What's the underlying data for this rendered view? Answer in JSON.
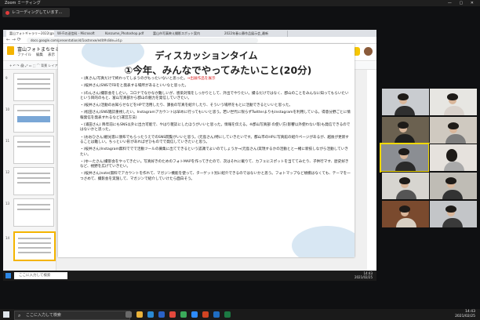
{
  "zoom": {
    "window_title": "Zoom ミーティング",
    "recording_label": "レコーディングしています..."
  },
  "browser": {
    "tabs": [
      "富山フォトギャラリー2022(gallery)",
      "Wi-Fiの送信料 - Microsoft",
      "Konzume_Photoshop.pdf",
      "富山市写真映え撮影スポット案内",
      "2022年春公募作品展示会_最新"
    ],
    "url": "docs.google.com/presentation/d/1ostnnxe/edit#slide=id.p"
  },
  "slides_app": {
    "doc_title": "富山フォトまちセミナー0325upl",
    "menu": [
      "ファイル",
      "編集",
      "表示",
      "挿入",
      "表示形式",
      "スライド",
      "配置",
      "ツール",
      "ヘルプ",
      "最終編集"
    ],
    "present_label": "プレゼンテーションを開始",
    "share_label": "共有",
    "toolbar_text": "+ ↶ ↷ 🖨 ⤢ ▭ ⬚ ⌒ 背景 レイアウト テーマ 切り替え効果"
  },
  "filmstrip": {
    "numbers": [
      "9",
      "10",
      "11",
      "12",
      "13",
      "14"
    ]
  },
  "slide": {
    "title": "ディスカッションタイム",
    "subtitle": "①今年、みんなでやってみたいこと(20分)",
    "notes": [
      {
        "text": "・(真さん)写真だけで終わってしまうのがもったいないと思った。",
        "red": "⇒出展作品を展示"
      },
      {
        "text": "・(桜井さん)SNSでFBをと発表する場所があるといいなと思った。",
        "red": ""
      },
      {
        "text": "・(のんさん)撮影会をしたい。コロナでなかなか難しいが、感染対策をしっかりとして、外出でやりたい。撮るだけではなく、郡山のことをみんなに知ってもらいたいという目的のもと、富山写真部から郡山の魅力を発信していきたい。",
        "red": ""
      },
      {
        "text": "・(桜井さん)活動のお知らせなどをHPで活用したり、課長の写真を紹介したり、そういう場所をもとに活動できるといいと思った。",
        "red": ""
      },
      {
        "text": "・(松田さん)SNS雑誌重視したい。Instagramアカウントは早めに行ってもいいと思う。若い世代に限らずTwitterよりもInstagramを利用している。得意分野ごとに情報発信を発表すれるなど(運営方法)",
        "red": ""
      },
      {
        "text": "・(浦田さん) 降年前にもSNS以外に出力可能で、やはり雑誌にしたほうがいいと思った。情報を伝える。",
        "red": "※郡山写真部 の使い方(影響以外使わない等)も発信できるのではないかと思った。"
      },
      {
        "text": "・(おおひさん)観光客に頒布でもらったうえでのSNS閲覧がいいと思う。(元島さん)特にしていきたいです。都山市のHPに写真館の紹介ページがあるが、越後が更新することは難しい。ちっといい形があればぜひものでで発信していきたいと思う。",
        "red": ""
      },
      {
        "text": "・(桜井さん)Instagram無料ででで活動ツールの募集に出てできるという認識でよいのでしょうか→(元島さん)実現するかの活動とと一緒に新技しながら活動していきたい。",
        "red": ""
      },
      {
        "text": "・(ゆーたさん)撮影会をやってきたい。写真好きのためのフォトMAPを作ってきたので、次はそれに載りて、カフェにスポットを当ててみたり、子供行マす、歴史好きなど、視野を広げていきたい。",
        "red": ""
      },
      {
        "text": "・(桜井さん)note(無料でアカウントを作れて、マガジン機能を使って、ターゲット別に紹介できるのではないかと思う。フォトマップなど規模はなくても、テーマを一つさめて、撮影会を実施して、マガジンで紹介していけたら面白そう。",
        "red": ""
      }
    ],
    "footer_text": "クリックしてスピーカーノートを追加"
  },
  "inner_taskbar": {
    "search_placeholder": "ここに入力して検索",
    "time": "14:43",
    "date": "2021/02/25"
  },
  "windows_taskbar": {
    "search_placeholder": "ここに入力して検索",
    "time": "14:43",
    "date": "2021/02/25"
  },
  "colors": {
    "accent_yellow": "#f4b400",
    "speaking_border": "#f0d800",
    "highlight_red": "#d62020"
  }
}
